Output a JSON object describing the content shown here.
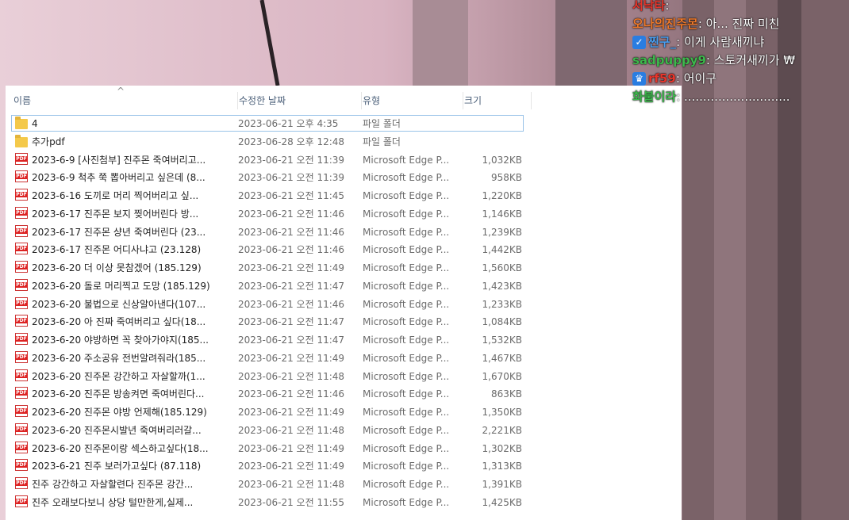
{
  "explorer": {
    "columns": {
      "name": "이름",
      "date": "수정한 날짜",
      "type": "유형",
      "size": "크기"
    },
    "sort_caret": "^",
    "rows": [
      {
        "icon": "folder-icon",
        "name": "4",
        "date": "2023-06-21 오후 4:35",
        "type": "파일 폴더",
        "size": ""
      },
      {
        "icon": "folder-icon",
        "name": "추가pdf",
        "date": "2023-06-28 오후 12:48",
        "type": "파일 폴더",
        "size": ""
      },
      {
        "icon": "pdf-icon",
        "name": "2023-6-9 [사진첨부] 진주몬 죽여버리고...",
        "date": "2023-06-21 오전 11:39",
        "type": "Microsoft Edge P...",
        "size": "1,032KB"
      },
      {
        "icon": "pdf-icon",
        "name": "2023-6-9 척추 쭉 뽑아버리고 싶은데 (8...",
        "date": "2023-06-21 오전 11:39",
        "type": "Microsoft Edge P...",
        "size": "958KB"
      },
      {
        "icon": "pdf-icon",
        "name": "2023-6-16 도끼로 머리 찍어버리고 싶...",
        "date": "2023-06-21 오전 11:45",
        "type": "Microsoft Edge P...",
        "size": "1,220KB"
      },
      {
        "icon": "pdf-icon",
        "name": "2023-6-17 진주몬 보지 찢어버린다 방...",
        "date": "2023-06-21 오전 11:46",
        "type": "Microsoft Edge P...",
        "size": "1,146KB"
      },
      {
        "icon": "pdf-icon",
        "name": "2023-6-17 진주몬 샹년 죽여버린다 (23...",
        "date": "2023-06-21 오전 11:46",
        "type": "Microsoft Edge P...",
        "size": "1,239KB"
      },
      {
        "icon": "pdf-icon",
        "name": "2023-6-17 진주몬 어디사냐고 (23.128)",
        "date": "2023-06-21 오전 11:46",
        "type": "Microsoft Edge P...",
        "size": "1,442KB"
      },
      {
        "icon": "pdf-icon",
        "name": "2023-6-20 더 이상 못참겠어 (185.129)",
        "date": "2023-06-21 오전 11:49",
        "type": "Microsoft Edge P...",
        "size": "1,560KB"
      },
      {
        "icon": "pdf-icon",
        "name": "2023-6-20 돌로 머리찍고 도망 (185.129)",
        "date": "2023-06-21 오전 11:47",
        "type": "Microsoft Edge P...",
        "size": "1,423KB"
      },
      {
        "icon": "pdf-icon",
        "name": "2023-6-20 불법으로 신상알아낸다(107...",
        "date": "2023-06-21 오전 11:46",
        "type": "Microsoft Edge P...",
        "size": "1,233KB"
      },
      {
        "icon": "pdf-icon",
        "name": "2023-6-20 아 진짜 죽여버리고 싶다(18...",
        "date": "2023-06-21 오전 11:47",
        "type": "Microsoft Edge P...",
        "size": "1,084KB"
      },
      {
        "icon": "pdf-icon",
        "name": "2023-6-20 야방하면 꼭 찾아가야지(185...",
        "date": "2023-06-21 오전 11:47",
        "type": "Microsoft Edge P...",
        "size": "1,532KB"
      },
      {
        "icon": "pdf-icon",
        "name": "2023-6-20 주소공유 전번알려줘라(185...",
        "date": "2023-06-21 오전 11:49",
        "type": "Microsoft Edge P...",
        "size": "1,467KB"
      },
      {
        "icon": "pdf-icon",
        "name": "2023-6-20 진주몬 강간하고 자살할까(1...",
        "date": "2023-06-21 오전 11:48",
        "type": "Microsoft Edge P...",
        "size": "1,670KB"
      },
      {
        "icon": "pdf-icon",
        "name": "2023-6-20 진주몬 방송켜면 죽여버린다...",
        "date": "2023-06-21 오전 11:46",
        "type": "Microsoft Edge P...",
        "size": "863KB"
      },
      {
        "icon": "pdf-icon",
        "name": "2023-6-20 진주몬 야방 언제해(185.129)",
        "date": "2023-06-21 오전 11:49",
        "type": "Microsoft Edge P...",
        "size": "1,350KB"
      },
      {
        "icon": "pdf-icon",
        "name": "2023-6-20 진주몬시발년 죽여버리러갈...",
        "date": "2023-06-21 오전 11:48",
        "type": "Microsoft Edge P...",
        "size": "2,221KB"
      },
      {
        "icon": "pdf-icon",
        "name": "2023-6-20 진주몬이랑 섹스하고싶다(18...",
        "date": "2023-06-21 오전 11:49",
        "type": "Microsoft Edge P...",
        "size": "1,302KB"
      },
      {
        "icon": "pdf-icon",
        "name": "2023-6-21 진주 보러가고싶다 (87.118)",
        "date": "2023-06-21 오전 11:49",
        "type": "Microsoft Edge P...",
        "size": "1,313KB"
      },
      {
        "icon": "pdf-icon",
        "name": "진주 강간하고 자살할련다 진주몬 강간...",
        "date": "2023-06-21 오전 11:48",
        "type": "Microsoft Edge P...",
        "size": "1,391KB"
      },
      {
        "icon": "pdf-icon",
        "name": "진주 오래보다보니 상당 털만한게,실제...",
        "date": "2023-06-21 오전 11:55",
        "type": "Microsoft Edge P...",
        "size": "1,425KB"
      }
    ],
    "pdf_icon_text": "PDF"
  },
  "chat": [
    {
      "user": "서낙타",
      "sep": ": ",
      "msg": "",
      "user_color": "#e8352b",
      "badge": ""
    },
    {
      "user": "오나의진주몬",
      "sep": ": ",
      "msg": "아... 진짜 미친",
      "user_color": "#f07a2a",
      "badge": ""
    },
    {
      "user": "찐구_",
      "sep": ": ",
      "msg": "이게 사람새끼냐",
      "user_color": "#4a9ff0",
      "badge": "check-badge-icon"
    },
    {
      "user": "sadpuppy9",
      "sep": ": ",
      "msg": "스토커새끼가 ₩",
      "user_color": "#3db84c",
      "badge": ""
    },
    {
      "user": "rf59",
      "sep": ": ",
      "msg": "어이구",
      "user_color": "#e8352b",
      "badge": "crown-badge-icon"
    },
    {
      "user": "화불이라",
      "sep": ": ",
      "msg": "............................",
      "user_color": "#3db84c",
      "badge": ""
    }
  ]
}
